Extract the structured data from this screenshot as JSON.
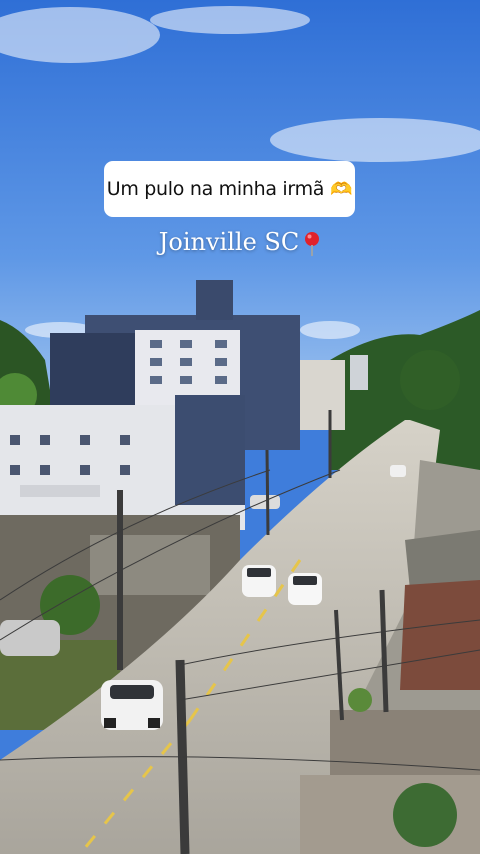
{
  "story": {
    "caption_text": "Um pulo na minha irmã",
    "caption_emoji": "🫶",
    "location_text": "Joinville SC",
    "location_icon": "round-pushpin-icon"
  },
  "colors": {
    "sky_top": "#2f6fd6",
    "sky_bottom": "#8bb8ee",
    "street": "#b9b4aa",
    "sidewalk": "#9a958c",
    "building_dark": "#3e4f73",
    "building_white": "#e6e8ec",
    "trees": "#2f5a24"
  }
}
